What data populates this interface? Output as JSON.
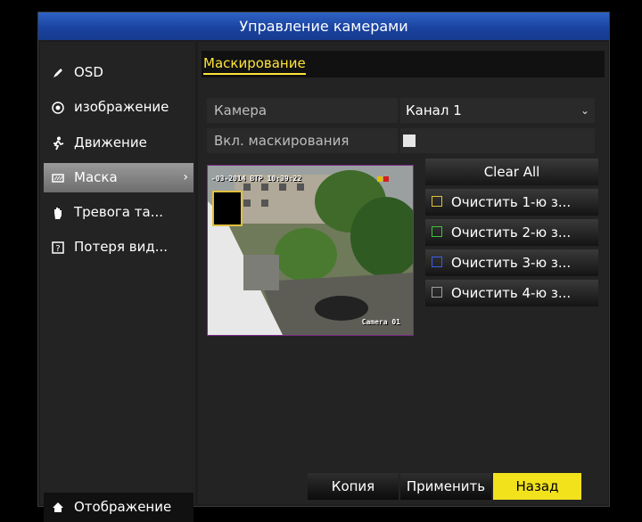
{
  "title": "Управление камерами",
  "sidebar": {
    "items": [
      {
        "label": "OSD",
        "icon": "brush-icon"
      },
      {
        "label": "изображение",
        "icon": "image-adjust-icon"
      },
      {
        "label": "Движение",
        "icon": "running-man-icon"
      },
      {
        "label": "Маска",
        "icon": "mask-icon",
        "active": true
      },
      {
        "label": "Тревога та...",
        "icon": "hand-icon"
      },
      {
        "label": "Потеря вид...",
        "icon": "video-loss-icon"
      }
    ],
    "display_label": "Отображение"
  },
  "tab": "Маскирование",
  "camera": {
    "label": "Камера",
    "value": "Канал 1"
  },
  "enable_mask": {
    "label": "Вкл. маскирования",
    "checked": false
  },
  "preview": {
    "osd": "-03-2014 ВТР 10:39:22",
    "camera_name": "Camera 01"
  },
  "clear_all": "Clear All",
  "clear_buttons": [
    {
      "label": "Очистить 1-ю з...",
      "color": "#e0c040"
    },
    {
      "label": "Очистить 2-ю з...",
      "color": "#3cc43c"
    },
    {
      "label": "Очистить 3-ю з...",
      "color": "#3c5cf0"
    },
    {
      "label": "Очистить 4-ю з...",
      "color": "#a0a0a0"
    }
  ],
  "buttons": {
    "copy": "Копия",
    "apply": "Применить",
    "back": "Назад"
  }
}
